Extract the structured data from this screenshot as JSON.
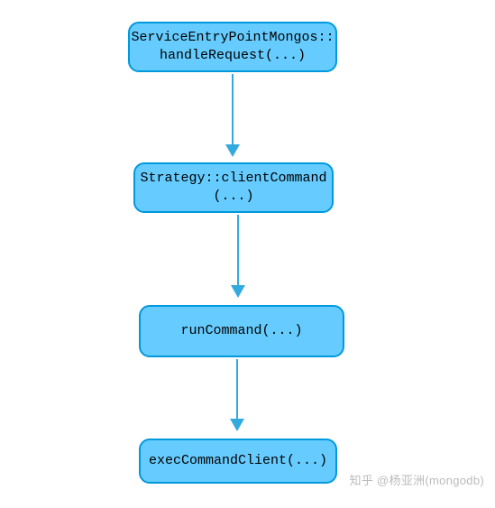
{
  "nodes": {
    "n1": "ServiceEntryPointMongos::\nhandleRequest(...)",
    "n2": "Strategy::clientCommand\n(...)",
    "n3": "runCommand(...)",
    "n4": "execCommandClient(...)"
  },
  "watermark": "知乎 @杨亚洲(mongodb)"
}
